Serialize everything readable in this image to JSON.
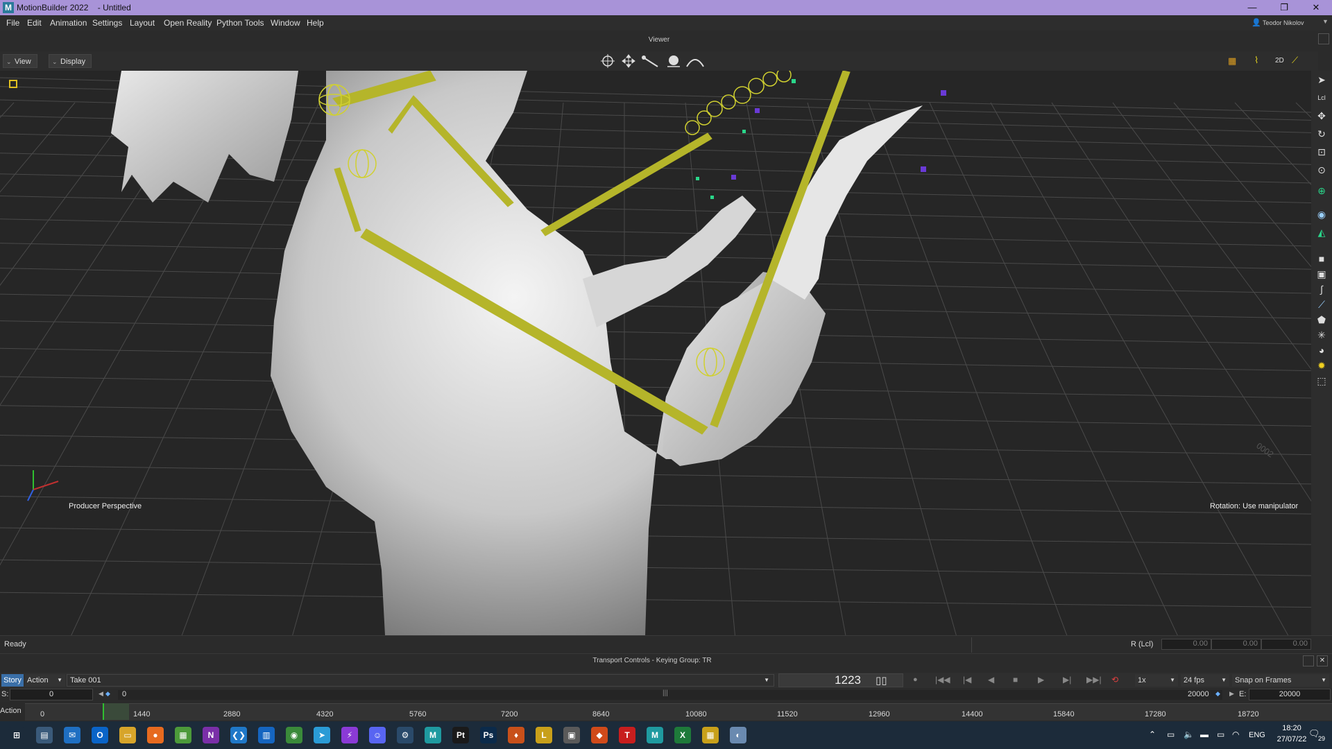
{
  "window": {
    "title": "MotionBuilder 2022    - Untitled",
    "logo": "M",
    "user": "Teodor Nikolov"
  },
  "menu": [
    "File",
    "Edit",
    "Animation",
    "Settings",
    "Layout",
    "Open Reality",
    "Python Tools",
    "Window",
    "Help"
  ],
  "viewer": {
    "label": "Viewer",
    "view_btn": "View",
    "display_btn": "Display",
    "camera_label": "Producer Perspective",
    "rotation_label": "Rotation: Use manipulator",
    "grid_marker": "0002"
  },
  "status": {
    "text": "Ready",
    "coord_mode": "R (Lcl)",
    "values": [
      "0.00",
      "0.00",
      "0.00"
    ]
  },
  "transport": {
    "title": "Transport Controls  -  Keying Group: TR",
    "story_tab": "Story",
    "action_tab": "Action",
    "take": "Take 001",
    "frame": "1223",
    "speed": "1x",
    "fps": "24 fps",
    "snap": "Snap on Frames",
    "start_label": "S:",
    "start_value": "0",
    "start_slider": "0",
    "end_slider": "20000",
    "end_label": "E:",
    "end_value": "20000"
  },
  "timeline": {
    "label": "Action",
    "ticks": [
      "0",
      "1440",
      "2880",
      "4320",
      "5760",
      "7200",
      "8640",
      "10080",
      "11520",
      "12960",
      "14400",
      "15840",
      "17280",
      "18720"
    ]
  },
  "taskbar": {
    "apps": [
      {
        "name": "start",
        "label": "⊞",
        "color": "#1c2b3a"
      },
      {
        "name": "explorer-pc",
        "label": "▤",
        "color": "#3a5a7a"
      },
      {
        "name": "mail",
        "label": "✉",
        "color": "#1f6fc2"
      },
      {
        "name": "outlook",
        "label": "O",
        "color": "#0a64c8"
      },
      {
        "name": "file-explorer",
        "label": "▭",
        "color": "#d7a52a"
      },
      {
        "name": "firefox",
        "label": "●",
        "color": "#e66a1f"
      },
      {
        "name": "notepad",
        "label": "▦",
        "color": "#4c9a3a"
      },
      {
        "name": "onenote",
        "label": "N",
        "color": "#7a2fa8"
      },
      {
        "name": "vscode",
        "label": "❮❯",
        "color": "#1f78c8"
      },
      {
        "name": "trello",
        "label": "▥",
        "color": "#1565c0"
      },
      {
        "name": "chrome",
        "label": "◉",
        "color": "#3a8a3a"
      },
      {
        "name": "telegram",
        "label": "➤",
        "color": "#2a9bd6"
      },
      {
        "name": "messenger",
        "label": "⚡",
        "color": "#8a3ad6"
      },
      {
        "name": "discord",
        "label": "☺",
        "color": "#5865f2"
      },
      {
        "name": "steam",
        "label": "⚙",
        "color": "#2a4a6a"
      },
      {
        "name": "motionbuilder",
        "label": "M",
        "color": "#1f9aa0"
      },
      {
        "name": "pycharm",
        "label": "Pt",
        "color": "#1a1a1a"
      },
      {
        "name": "photoshop",
        "label": "Ps",
        "color": "#0b2a4a"
      },
      {
        "name": "app-flame",
        "label": "♦",
        "color": "#c8501a"
      },
      {
        "name": "app-l",
        "label": "L",
        "color": "#c8a01a"
      },
      {
        "name": "monitor",
        "label": "▣",
        "color": "#5a5a5a"
      },
      {
        "name": "app-git",
        "label": "◆",
        "color": "#d04a1a"
      },
      {
        "name": "app-t",
        "label": "T",
        "color": "#c81e1e"
      },
      {
        "name": "motionbuilder-active",
        "label": "M",
        "color": "#1f9aa0"
      },
      {
        "name": "excel",
        "label": "X",
        "color": "#1e7a3a"
      },
      {
        "name": "calendar",
        "label": "▦",
        "color": "#c8a01a"
      },
      {
        "name": "app-globe",
        "label": "◐",
        "color": "#6a8ab0"
      }
    ],
    "lang": "ENG",
    "time": "18:20",
    "date": "27/07/22",
    "notifications": "29"
  },
  "colors": {
    "titlebar": "#a893d8",
    "bone": "#b5b52a",
    "taskbar": "#1c2b3a"
  }
}
